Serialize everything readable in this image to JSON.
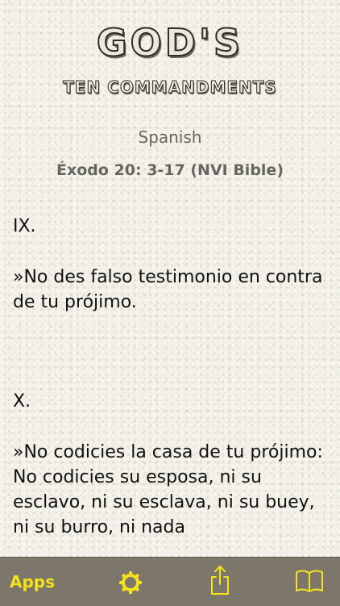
{
  "header": {
    "logo_title": "GOD'S",
    "logo_subtitle": "TEN COMMANDMENTS",
    "language": "Spanish",
    "reference": "Éxodo 20: 3-17 (NVI Bible)"
  },
  "commandments": [
    {
      "number": "IX.",
      "text": "»No des falso testimonio en contra de tu prójimo."
    },
    {
      "number": "X.",
      "text": "»No codicies la casa de tu prójimo: No codicies su esposa, ni su esclavo, ni su esclava, ni su buey, ni su burro, ni nada"
    }
  ],
  "toolbar": {
    "apps_label": "Apps",
    "icons": [
      "gear-icon",
      "share-icon",
      "book-icon"
    ]
  },
  "colors": {
    "toolbar_bg": "#7d776b",
    "accent_yellow": "#f4e21d",
    "muted_text": "#66655f",
    "body_text": "#111111"
  }
}
